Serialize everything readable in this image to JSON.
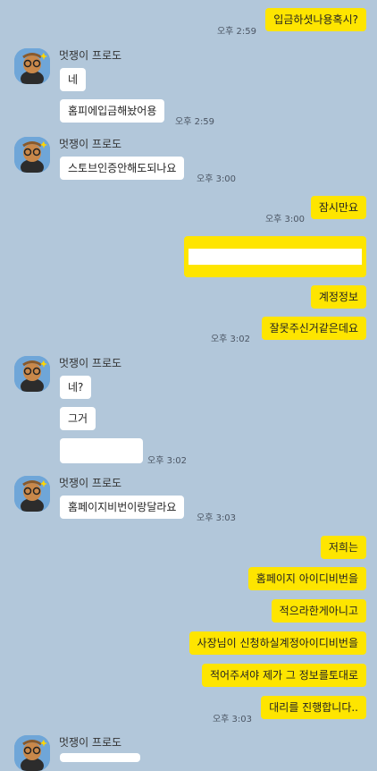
{
  "sender": "멋쟁이 프로도",
  "colors": {
    "background": "#b2c7da",
    "my_bubble": "#fee500",
    "other_bubble": "#ffffff"
  },
  "messages": {
    "m1": "입금하셧나용혹시?",
    "m2": "네",
    "m3": "홈피에입금해놨어용",
    "m4": "스토브인증안해도되나요",
    "m5": "잠시만요",
    "m6": "",
    "m7": "계정정보",
    "m8": "잘못주신거같은데요",
    "m9": "네?",
    "m10": "그거",
    "m11": "",
    "m12": "홈페이지비번이랑달라요",
    "m13": "저희는",
    "m14": "홈페이지 아이디비번을",
    "m15": "적으라한게아니고",
    "m16": "사장님이 신청하실계정아이디비번을",
    "m17": "적어주셔야 제가 그 정보를토대로",
    "m18": "대리를 진행합니다.."
  },
  "times": {
    "t1": "오후 2:59",
    "t2": "오후 2:59",
    "t3": "오후 3:00",
    "t4": "오후 3:00",
    "t5": "오후 3:02",
    "t6": "오후 3:02",
    "t7": "오후 3:03",
    "t8": "오후 3:03"
  },
  "avatar_icon": "frodo-avatar-icon"
}
